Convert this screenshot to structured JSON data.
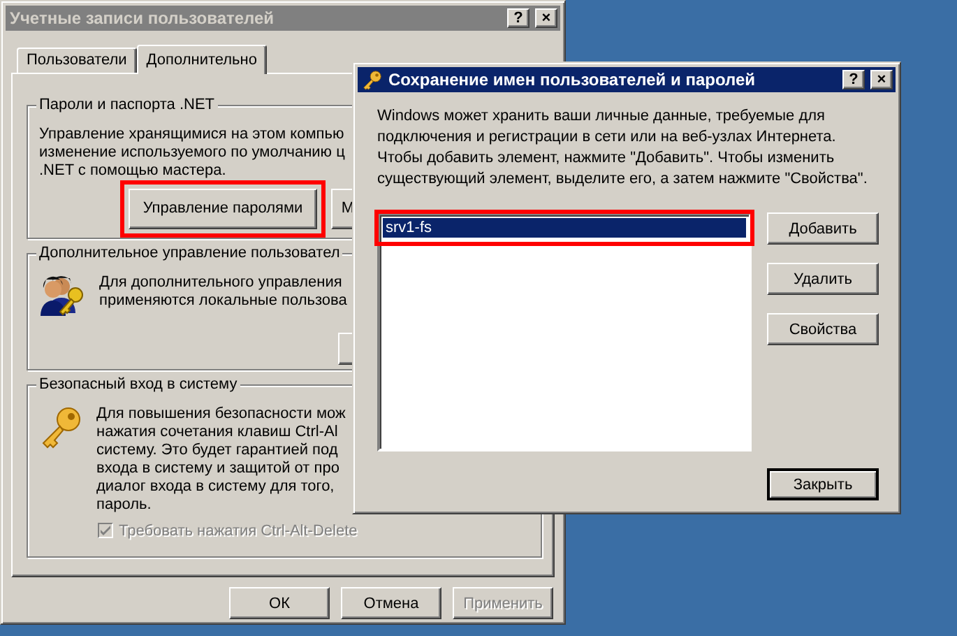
{
  "back_window": {
    "title": "Учетные записи пользователей",
    "active": false,
    "title_buttons": [
      "?",
      "×"
    ],
    "tabs": [
      {
        "label": "Пользователи",
        "selected": false
      },
      {
        "label": "Дополнительно",
        "selected": true
      }
    ],
    "groups": [
      {
        "kind": "text",
        "title": "Пароли и паспорта .NET",
        "lines": [
          "Управление хранящимися на этом компью",
          "изменение используемого по умолчанию ц",
          ".NET с помощью мастера."
        ],
        "buttons": [
          {
            "label": "Управление паролями",
            "highlighted": true
          },
          {
            "label": "М",
            "highlighted": false
          }
        ]
      },
      {
        "kind": "users",
        "title": "Дополнительное управление пользовател",
        "lines": [
          "Для дополнительного управления",
          "применяются локальные пользова"
        ]
      },
      {
        "kind": "key",
        "title": "Безопасный вход в систему",
        "lines": [
          "Для повышения безопасности мож",
          "нажатия сочетания клавиш Ctrl-Al",
          "систему. Это будет гарантией под",
          "входа в систему и защитой от про",
          "диалог входа в систему для того,",
          "пароль."
        ],
        "checkbox": {
          "label": "Требовать нажатия Ctrl-Alt-Delete",
          "checked": true,
          "disabled": true
        }
      }
    ],
    "buttons": [
      {
        "label": "ОК",
        "disabled": false
      },
      {
        "label": "Отмена",
        "disabled": false
      },
      {
        "label": "Применить",
        "disabled": true
      }
    ]
  },
  "dialog": {
    "title": "Сохранение имен пользователей и паролей",
    "active": true,
    "title_buttons": [
      "?",
      "×"
    ],
    "lines": [
      "Windows может хранить ваши личные данные, требуемые для",
      "подключения и регистрации в сети или на веб-узлах Интернета.",
      "Чтобы добавить элемент, нажмите \"Добавить\". Чтобы изменить",
      "существующий элемент, выделите его, а затем нажмите \"Свойства\"."
    ],
    "items": [
      {
        "label": "srv1-fs",
        "selected": true,
        "highlighted": true
      }
    ],
    "side_buttons": [
      {
        "label": "Добавить"
      },
      {
        "label": "Удалить"
      },
      {
        "label": "Свойства"
      }
    ],
    "close_button": {
      "label": "Закрыть",
      "default": true
    }
  }
}
